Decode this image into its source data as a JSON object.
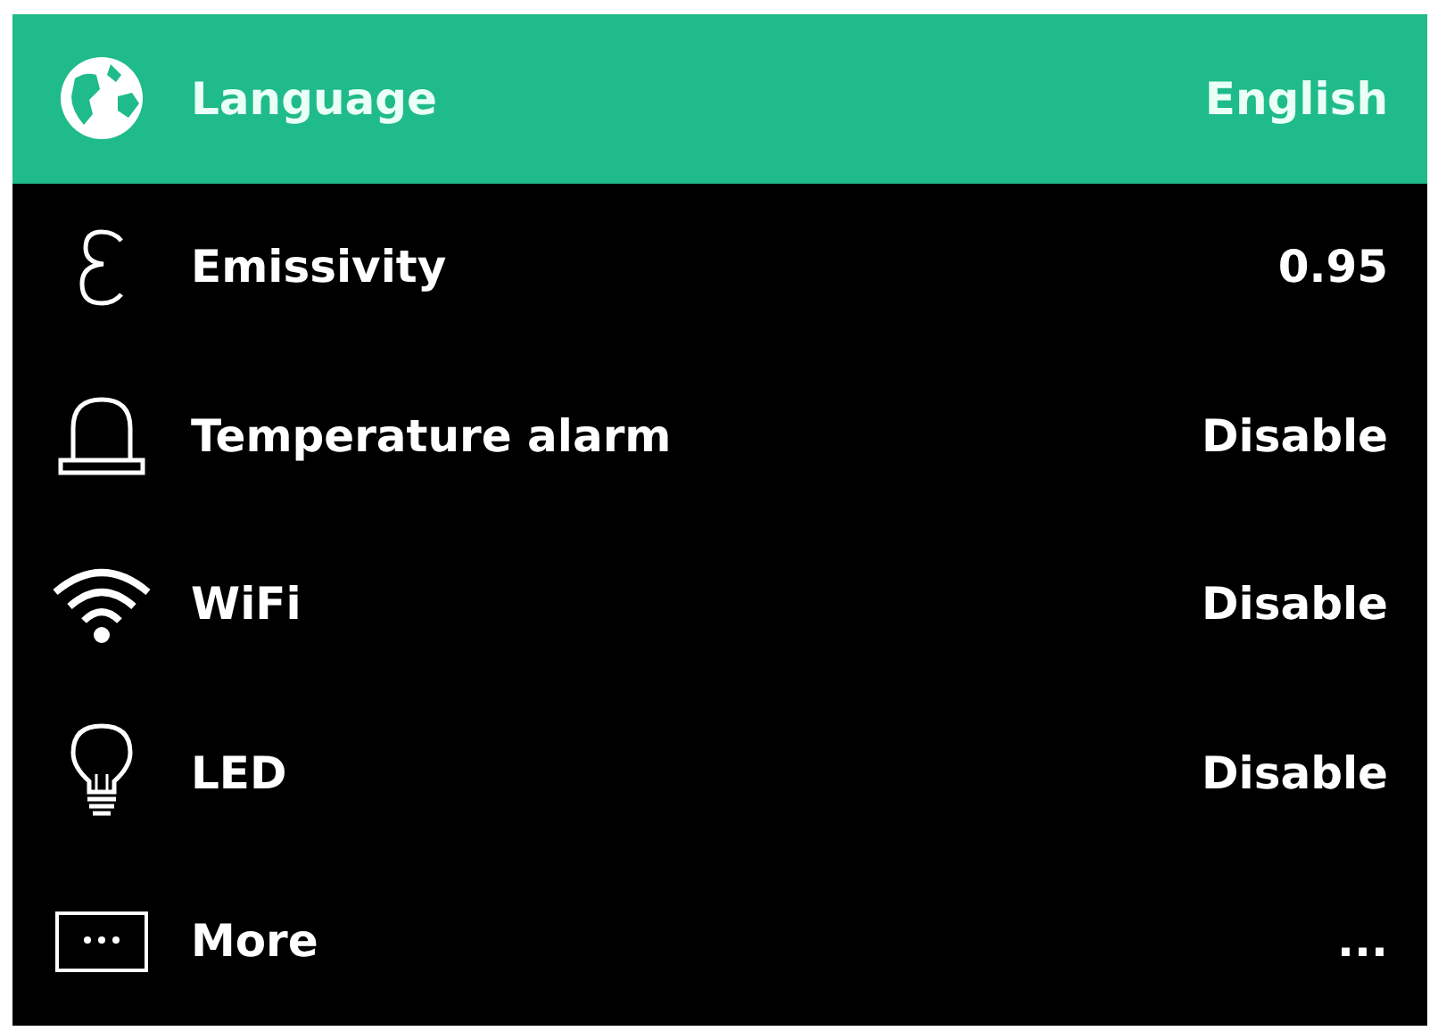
{
  "settings": [
    {
      "kind": "globe",
      "label": "Language",
      "value": "English",
      "selected": true
    },
    {
      "kind": "epsilon",
      "label": "Emissivity",
      "value": "0.95",
      "selected": false
    },
    {
      "kind": "alarm",
      "label": "Temperature alarm",
      "value": "Disable",
      "selected": false
    },
    {
      "kind": "wifi",
      "label": "WiFi",
      "value": "Disable",
      "selected": false
    },
    {
      "kind": "bulb",
      "label": "LED",
      "value": "Disable",
      "selected": false
    },
    {
      "kind": "more",
      "label": "More",
      "value": "...",
      "selected": false
    }
  ]
}
